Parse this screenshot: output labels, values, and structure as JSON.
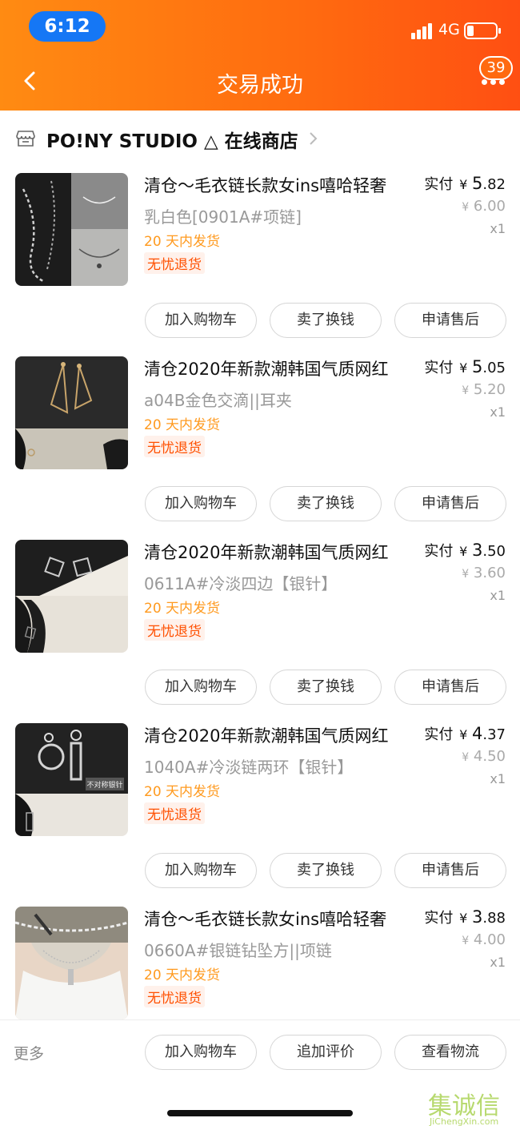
{
  "status_bar": {
    "time": "6:12",
    "network": "4G"
  },
  "nav": {
    "title": "交易成功",
    "badge": "39"
  },
  "shop": {
    "name": "PO!NY STUDIO △ 在线商店"
  },
  "labels": {
    "paid": "实付",
    "currency": "¥",
    "shipping": "20 天内发货",
    "return_policy": "无忧退货"
  },
  "items": [
    {
      "title": "清仓～毛衣链长款女ins嘻哈轻奢",
      "sku": "乳白色[0901A#项链]",
      "paid_int": "5",
      "paid_dec": ".82",
      "orig": "6.00",
      "qty": "x1",
      "buttons": [
        "加入购物车",
        "卖了换钱",
        "申请售后"
      ]
    },
    {
      "title": "清仓2020年新款潮韩国气质网红",
      "sku": "a04B金色交滴||耳夹",
      "paid_int": "5",
      "paid_dec": ".05",
      "orig": "5.20",
      "qty": "x1",
      "buttons": [
        "加入购物车",
        "卖了换钱",
        "申请售后"
      ]
    },
    {
      "title": "清仓2020年新款潮韩国气质网红",
      "sku": "0611A#冷淡四边【银针】",
      "paid_int": "3",
      "paid_dec": ".50",
      "orig": "3.60",
      "qty": "x1",
      "buttons": [
        "加入购物车",
        "卖了换钱",
        "申请售后"
      ]
    },
    {
      "title": "清仓2020年新款潮韩国气质网红",
      "sku": "1040A#冷淡链两环【银针】",
      "paid_int": "4",
      "paid_dec": ".37",
      "orig": "4.50",
      "qty": "x1",
      "buttons": [
        "加入购物车",
        "卖了换钱",
        "申请售后"
      ],
      "thumb_text": "不对称银针"
    },
    {
      "title": "清仓～毛衣链长款女ins嘻哈轻奢",
      "sku": "0660A#银链钻坠方||项链",
      "paid_int": "3",
      "paid_dec": ".88",
      "orig": "4.00",
      "qty": "x1"
    }
  ],
  "bottom_bar": {
    "more": "更多",
    "buttons": [
      "加入购物车",
      "追加评价",
      "查看物流"
    ]
  },
  "watermark": {
    "logo": "集诚信",
    "url": "JiChengXin.com"
  },
  "colors": {
    "accent": "#ff6a10",
    "ship_text": "#ff9a1f",
    "return_text": "#ff5000",
    "time_pill": "#1577f5"
  }
}
